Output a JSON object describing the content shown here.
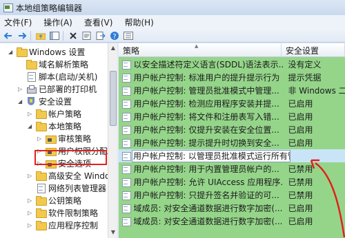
{
  "window": {
    "title": "本地组策略编辑器"
  },
  "menu": [
    "文件(F)",
    "操作(A)",
    "查看(V)",
    "帮助(H)"
  ],
  "toolbar": [
    "back-icon",
    "forward-icon",
    "folder-up-icon",
    "show-hide-tree-icon",
    "delete-icon",
    "properties-icon",
    "export-icon",
    "help-icon",
    "view-icon"
  ],
  "tree": {
    "items": [
      {
        "label": "Windows 设置",
        "icon": "folder-icon",
        "expand": "◢"
      },
      {
        "label": "域名解析策略",
        "icon": "folder-icon",
        "expand": ""
      },
      {
        "label": "脚本(启动/关机)",
        "icon": "script-icon",
        "expand": ""
      },
      {
        "label": "已部署的打印机",
        "icon": "printer-icon",
        "expand": "▷"
      },
      {
        "label": "安全设置",
        "icon": "shield-icon",
        "expand": "◢"
      },
      {
        "label": "帐户策略",
        "icon": "folder-icon",
        "expand": "▷"
      },
      {
        "label": "本地策略",
        "icon": "folder-icon",
        "expand": "◢"
      },
      {
        "label": "审核策略",
        "icon": "folder-icon",
        "expand": "▷"
      },
      {
        "label": "用户权限分配",
        "icon": "folder-icon",
        "expand": "▷"
      },
      {
        "label": "安全选项",
        "icon": "folder-icon",
        "expand": "▷"
      },
      {
        "label": "高级安全 Windo",
        "icon": "folder-icon",
        "expand": "▷"
      },
      {
        "label": "网络列表管理器",
        "icon": "doc-icon",
        "expand": ""
      },
      {
        "label": "公钥策略",
        "icon": "folder-icon",
        "expand": "▷"
      },
      {
        "label": "软件限制策略",
        "icon": "folder-icon",
        "expand": "▷"
      },
      {
        "label": "应用程序控制",
        "icon": "folder-icon",
        "expand": "▷"
      }
    ]
  },
  "list": {
    "headers": {
      "policy": "策略",
      "setting": "安全设置"
    },
    "rows": [
      {
        "policy": "以安全描述符定义语言(SDDL)语法表示...",
        "setting": "没有定义"
      },
      {
        "policy": "用户帐户控制: 标准用户的提升提示行为",
        "setting": "提示凭据"
      },
      {
        "policy": "用户帐户控制: 管理员批准模式中管理...",
        "setting": "非 Windows 二..."
      },
      {
        "policy": "用户帐户控制: 检测应用程序安装并提...",
        "setting": "已启用"
      },
      {
        "policy": "用户帐户控制: 将文件和注册表写入错...",
        "setting": "已启用"
      },
      {
        "policy": "用户帐户控制: 仅提升安装在安全位置...",
        "setting": "已启用"
      },
      {
        "policy": "用户帐户控制: 提示提升时切换到安全...",
        "setting": "已启用"
      },
      {
        "policy": "用户帐户控制: 以管理员批准模式运行所有管理员",
        "setting": ""
      },
      {
        "policy": "用户帐户控制: 用于内置管理员帐户的...",
        "setting": "已禁用"
      },
      {
        "policy": "用户帐户控制: 允许 UIAccess 应用程序...",
        "setting": "已禁用"
      },
      {
        "policy": "用户帐户控制: 只提升签名并验证的可...",
        "setting": "已禁用"
      },
      {
        "policy": "域成员: 对安全通道数据进行数字加密(...",
        "setting": "已启用"
      },
      {
        "policy": "域成员: 对安全通道数据进行数字加密(...",
        "setting": "已启用"
      }
    ]
  },
  "colors": {
    "list_bg": "#95d58a",
    "highlight": "#c9e4f7",
    "annotation": "#e0201c"
  }
}
